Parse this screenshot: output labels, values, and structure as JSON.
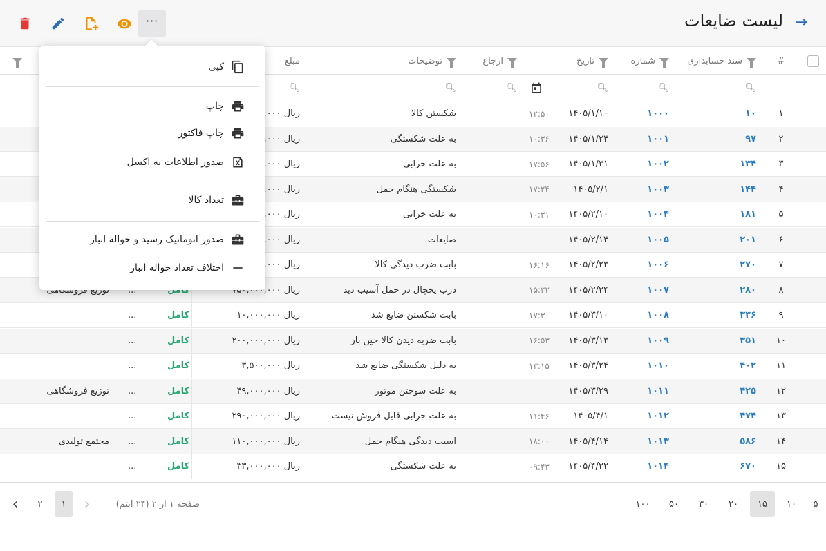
{
  "header": {
    "title": "لیست ضایعات",
    "more_label": "···"
  },
  "icons": {
    "back": "arrow-right-icon",
    "delete": "trash-icon",
    "edit": "pencil-icon",
    "add": "file-plus-icon",
    "view": "eye-icon"
  },
  "colors": {
    "accent_blue": "#2a6db3",
    "delete_red": "#e53935",
    "orange": "#f39200",
    "green": "#27a872"
  },
  "columns": {
    "index": "#",
    "doc": "سند حسابداری",
    "number": "شماره",
    "date": "تاریخ",
    "ref": "ارجاع",
    "desc": "توضیحات",
    "amount": "مبلغ"
  },
  "menu": {
    "copy": "کپی",
    "print": "چاپ",
    "print_invoice": "چاپ فاکتور",
    "export_excel": "صدور اطلاعات به اکسل",
    "item_count": "تعداد کالا",
    "auto_issue": "صدور اتوماتیک رسید و حواله انبار",
    "diff": "اختلاف تعداد حواله انبار"
  },
  "rows": [
    {
      "idx": "۱",
      "doc": "۱۰",
      "num": "۱۰۰۰",
      "date": "۱۴۰۵/۱/۱۰",
      "time": "۱۲:۵۰",
      "desc": "شکستن کالا",
      "amount": "ریال ۵,۰۰۰,۰۰۰",
      "status": "",
      "more": "",
      "dest": ""
    },
    {
      "idx": "۲",
      "doc": "۹۷",
      "num": "۱۰۰۱",
      "date": "۱۴۰۵/۱/۲۴",
      "time": "۱۰:۳۶",
      "desc": "به علت شکستگی",
      "amount": "ریال ۵,۰۰۰,۰۰۰",
      "status": "",
      "more": "",
      "dest": ""
    },
    {
      "idx": "۳",
      "doc": "۱۳۴",
      "num": "۱۰۰۲",
      "date": "۱۴۰۵/۱/۳۱",
      "time": "۱۷:۵۶",
      "desc": "به علت خرابی",
      "amount": "ریال ۵,۰۰۰,۰۰۰",
      "status": "",
      "more": "",
      "dest": ""
    },
    {
      "idx": "۴",
      "doc": "۱۴۴",
      "num": "۱۰۰۳",
      "date": "۱۴۰۵/۲/۱",
      "time": "۱۷:۲۴",
      "desc": "شکستگی هنگام حمل",
      "amount": "ریال ۵,۰۰۰,۰۰۰",
      "status": "",
      "more": "",
      "dest": ""
    },
    {
      "idx": "۵",
      "doc": "۱۸۱",
      "num": "۱۰۰۴",
      "date": "۱۴۰۵/۲/۱۰",
      "time": "۱۰:۳۱",
      "desc": "به علت خرابی",
      "amount": "ریال ۵,۰۰۰,۰۰۰",
      "status": "",
      "more": "",
      "dest": ""
    },
    {
      "idx": "۶",
      "doc": "۲۰۱",
      "num": "۱۰۰۵",
      "date": "۱۴۰۵/۲/۱۴",
      "time": "",
      "desc": "ضایعات",
      "amount": "ریال ۵,۰۰۰,۰۰۰",
      "status": "",
      "more": "",
      "dest": ""
    },
    {
      "idx": "۷",
      "doc": "۲۷۰",
      "num": "۱۰۰۶",
      "date": "۱۴۰۵/۲/۲۳",
      "time": "۱۶:۱۶",
      "desc": "بابت ضرب دیدگی کالا",
      "amount": "ریال ۵,۰۰۰,۰۰۰",
      "status": "",
      "more": "",
      "dest": ""
    },
    {
      "idx": "۸",
      "doc": "۲۸۰",
      "num": "۱۰۰۷",
      "date": "۱۴۰۵/۲/۲۴",
      "time": "۱۵:۲۲",
      "desc": "درب یخچال در حمل آسیب دید",
      "amount": "ریال ۷۵۰,۰۰۰,۰۰۰",
      "status": "کامل",
      "more": "...",
      "dest": "توزیع فروشگاهی"
    },
    {
      "idx": "۹",
      "doc": "۳۳۶",
      "num": "۱۰۰۸",
      "date": "۱۴۰۵/۳/۱۰",
      "time": "۱۷:۳۰",
      "desc": "بابت شکستن ضایع شد",
      "amount": "ریال ۱۰,۰۰۰,۰۰۰",
      "status": "کامل",
      "more": "...",
      "dest": ""
    },
    {
      "idx": "۱۰",
      "doc": "۳۵۱",
      "num": "۱۰۰۹",
      "date": "۱۴۰۵/۳/۱۳",
      "time": "۱۶:۵۳",
      "desc": "بابت ضربه دیدن کالا حین بار",
      "amount": "ریال ۲۰۰,۰۰۰,۰۰۰",
      "status": "کامل",
      "more": "...",
      "dest": ""
    },
    {
      "idx": "۱۱",
      "doc": "۴۰۲",
      "num": "۱۰۱۰",
      "date": "۱۴۰۵/۳/۲۴",
      "time": "۱۳:۱۵",
      "desc": "به دلیل شکستگی ضایع شد",
      "amount": "ریال ۳,۵۰۰,۰۰۰",
      "status": "کامل",
      "more": "...",
      "dest": ""
    },
    {
      "idx": "۱۲",
      "doc": "۴۲۵",
      "num": "۱۰۱۱",
      "date": "۱۴۰۵/۳/۲۹",
      "time": "",
      "desc": "به علت سوختن موتور",
      "amount": "ریال ۴۹,۰۰۰,۰۰۰",
      "status": "کامل",
      "more": "...",
      "dest": "توزیع فروشگاهی"
    },
    {
      "idx": "۱۳",
      "doc": "۴۷۴",
      "num": "۱۰۱۲",
      "date": "۱۴۰۵/۴/۱",
      "time": "۱۱:۴۶",
      "desc": "به علت خرابی قابل فروش نیست",
      "amount": "ریال ۲۹۰,۰۰۰,۰۰۰",
      "status": "کامل",
      "more": "...",
      "dest": ""
    },
    {
      "idx": "۱۴",
      "doc": "۵۸۶",
      "num": "۱۰۱۳",
      "date": "۱۴۰۵/۴/۱۴",
      "time": "۱۸:۰۰",
      "desc": "اسیب دیدگی هنگام حمل",
      "amount": "ریال ۱۱۰,۰۰۰,۰۰۰",
      "status": "کامل",
      "more": "...",
      "dest": "مجتمع تولیدی"
    },
    {
      "idx": "۱۵",
      "doc": "۶۷۰",
      "num": "۱۰۱۴",
      "date": "۱۴۰۵/۴/۲۲",
      "time": "۰۹:۴۳",
      "desc": "به علت شکستگی",
      "amount": "ریال ۳۳,۰۰۰,۰۰۰",
      "status": "کامل",
      "more": "...",
      "dest": ""
    }
  ],
  "pagination": {
    "info": "صفحه ۱ از ۲ (۲۴ آیتم)",
    "pages": [
      "۱",
      "۲"
    ],
    "current_page": 1,
    "page_sizes": [
      "۵",
      "۱۰",
      "۱۵",
      "۲۰",
      "۳۰",
      "۵۰",
      "۱۰۰"
    ],
    "selected_page_size": "۱۵"
  }
}
